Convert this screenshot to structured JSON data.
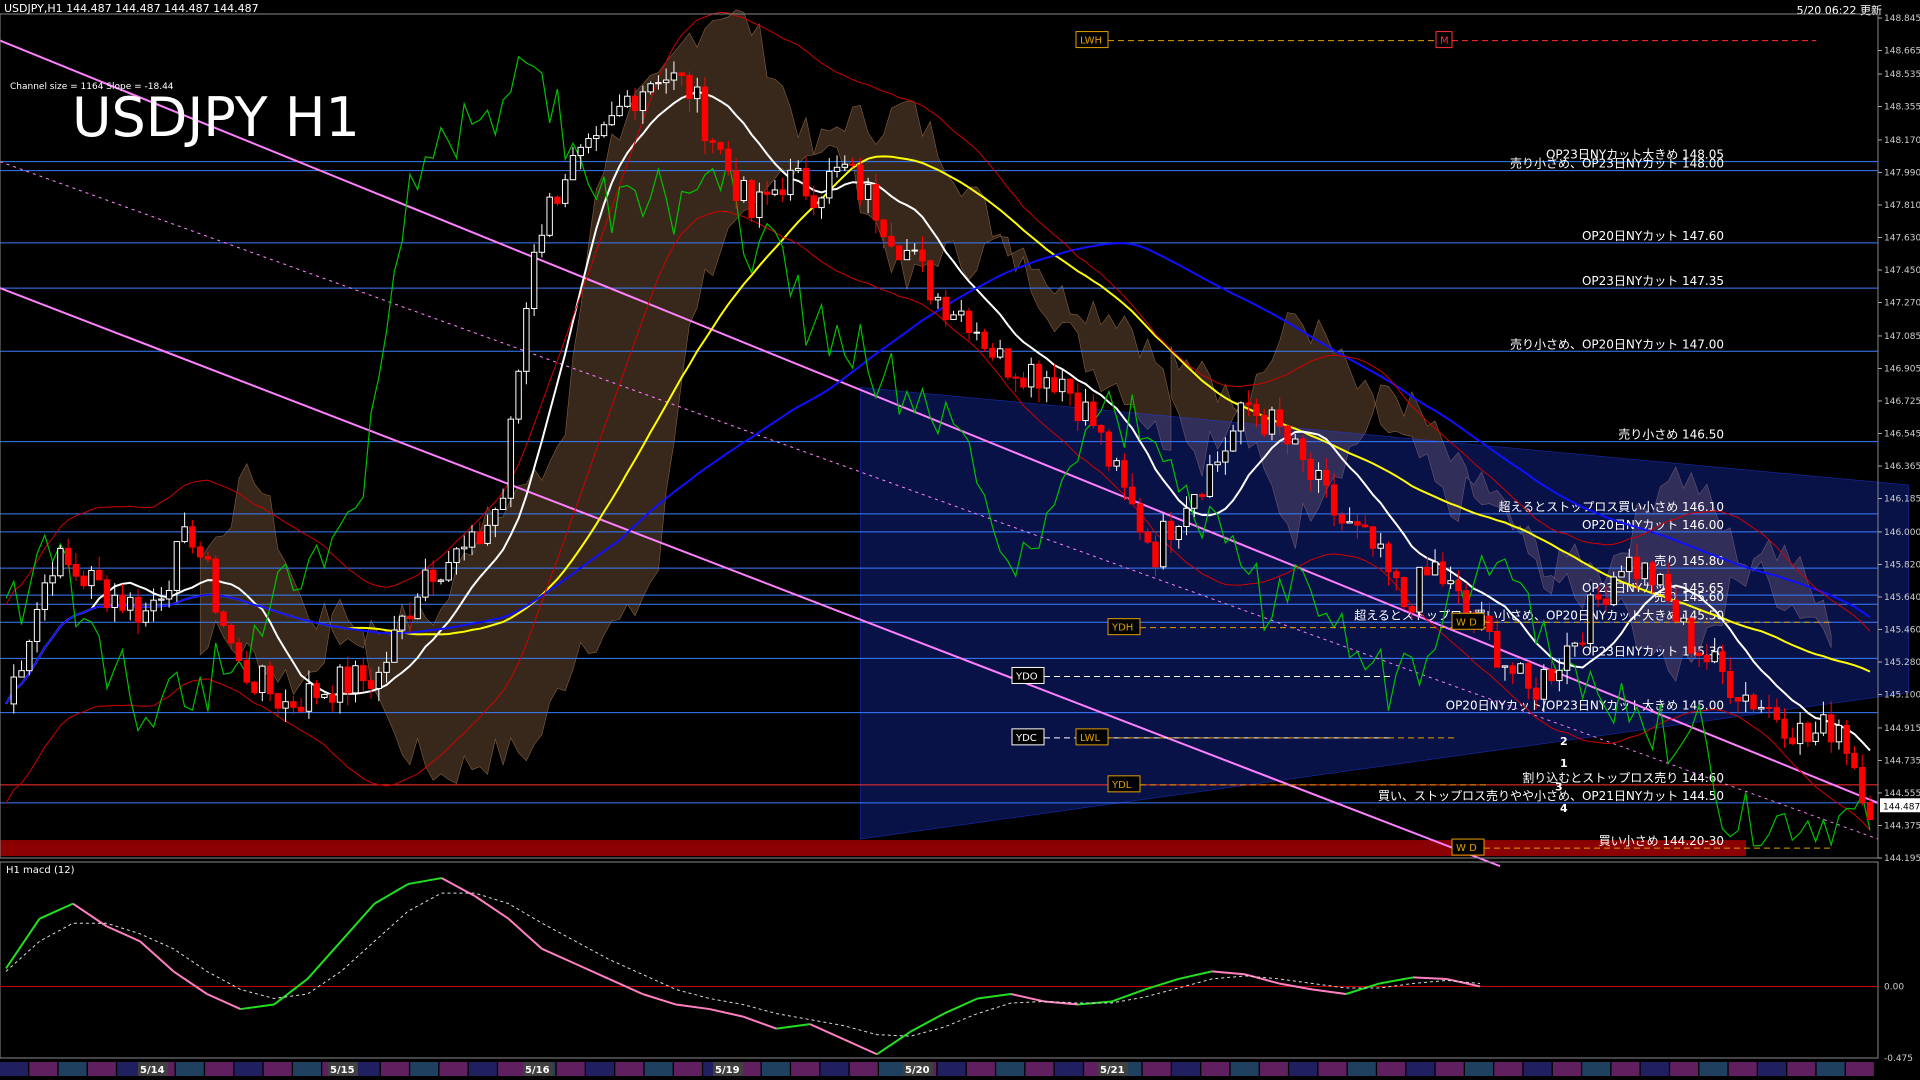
{
  "header": {
    "symbol_info": "USDJPY,H1  144.487 144.487 144.487 144.487",
    "timestamp": "5/20 06:22 更新"
  },
  "chart_data": [
    {
      "type": "candlestick",
      "title": "USDJPY H1",
      "subtitle": "Channel size = 1164 Slope = -18.44",
      "ylim": [
        144.195,
        148.845
      ],
      "y_ticks": [
        148.845,
        148.665,
        148.535,
        148.355,
        148.17,
        147.99,
        147.81,
        147.63,
        147.45,
        147.27,
        147.085,
        146.905,
        146.725,
        146.545,
        146.365,
        146.185,
        146.0,
        145.82,
        145.64,
        145.46,
        145.28,
        145.1,
        144.915,
        144.735,
        144.555,
        144.375,
        144.195
      ],
      "current_price": "144.487",
      "date_labels": [
        "5/14",
        "5/15",
        "5/16",
        "5/19",
        "5/20",
        "5/21"
      ],
      "candle_count": 240,
      "close_path": [
        [
          0,
          145.05
        ],
        [
          6,
          145.85
        ],
        [
          12,
          145.7
        ],
        [
          18,
          145.55
        ],
        [
          24,
          146.0
        ],
        [
          30,
          145.25
        ],
        [
          36,
          145.05
        ],
        [
          42,
          145.15
        ],
        [
          48,
          145.2
        ],
        [
          54,
          145.8
        ],
        [
          60,
          145.9
        ],
        [
          64,
          146.2
        ],
        [
          68,
          147.6
        ],
        [
          72,
          148.0
        ],
        [
          76,
          148.1
        ],
        [
          80,
          148.4
        ],
        [
          84,
          148.55
        ],
        [
          88,
          148.45
        ],
        [
          92,
          148.1
        ],
        [
          96,
          147.75
        ],
        [
          100,
          147.95
        ],
        [
          104,
          147.9
        ],
        [
          108,
          148.0
        ],
        [
          112,
          147.8
        ],
        [
          116,
          147.55
        ],
        [
          120,
          147.3
        ],
        [
          124,
          147.2
        ],
        [
          128,
          146.95
        ],
        [
          132,
          146.9
        ],
        [
          136,
          146.85
        ],
        [
          140,
          146.6
        ],
        [
          144,
          146.2
        ],
        [
          148,
          145.9
        ],
        [
          152,
          146.2
        ],
        [
          156,
          146.4
        ],
        [
          160,
          146.7
        ],
        [
          164,
          146.55
        ],
        [
          168,
          146.3
        ],
        [
          172,
          146.05
        ],
        [
          176,
          145.9
        ],
        [
          180,
          145.6
        ],
        [
          184,
          145.8
        ],
        [
          188,
          145.55
        ],
        [
          192,
          145.35
        ],
        [
          196,
          145.1
        ],
        [
          200,
          145.3
        ],
        [
          204,
          145.55
        ],
        [
          208,
          145.85
        ],
        [
          212,
          145.75
        ],
        [
          216,
          145.45
        ],
        [
          220,
          145.25
        ],
        [
          224,
          145.1
        ],
        [
          228,
          145.0
        ],
        [
          232,
          144.85
        ],
        [
          236,
          144.95
        ],
        [
          240,
          144.49
        ]
      ],
      "reference_lines": [
        {
          "label": "OP23日NYカット大きめ 148.05",
          "price": 148.05
        },
        {
          "label": "売り小さめ、OP23日NYカット 148.00",
          "price": 148.0
        },
        {
          "label": "OP20日NYカット 147.60",
          "price": 147.6
        },
        {
          "label": "OP23日NYカット 147.35",
          "price": 147.35
        },
        {
          "label": "売り小さめ、OP20日NYカット 147.00",
          "price": 147.0
        },
        {
          "label": "売り小さめ 146.50",
          "price": 146.5
        },
        {
          "label": "超えるとストップロス買い小さめ 146.10",
          "price": 146.1
        },
        {
          "label": "OP20日NYカット 146.00",
          "price": 146.0
        },
        {
          "label": "売り 145.80",
          "price": 145.8
        },
        {
          "label": "OP23日NYカット 145.65",
          "price": 145.65
        },
        {
          "label": "売り 145.60",
          "price": 145.6
        },
        {
          "label": "超えるとストップロス買い小さめ、OP20日NYカット大きめ 145.50",
          "price": 145.5
        },
        {
          "label": "OP23日NYカット 145.30",
          "price": 145.3
        },
        {
          "label": "OP20日NYカット/OP23日NYカット大きめ 145.00",
          "price": 145.0
        },
        {
          "label": "割り込むとストップロス売り 144.60",
          "price": 144.6
        },
        {
          "label": "買い、ストップロス売りやや小さめ、OP21日NYカット 144.50",
          "price": 144.5
        },
        {
          "label": "買い小さめ 144.20-30",
          "price": 144.25
        }
      ],
      "level_tags": [
        {
          "label": "LWH",
          "price": 148.72
        },
        {
          "label": "YDH",
          "price": 145.47
        },
        {
          "label": "YDO",
          "price": 145.2
        },
        {
          "label": "YDC",
          "price": 144.86
        },
        {
          "label": "LWL",
          "price": 144.86
        },
        {
          "label": "YDL",
          "price": 144.6
        },
        {
          "label": "W D",
          "price": 145.5
        },
        {
          "label": "W D",
          "price": 144.25
        },
        {
          "label": "M",
          "price": 148.72
        }
      ],
      "projection_labels": [
        "2",
        "1",
        "3",
        "4"
      ],
      "colors": {
        "up": "#ffffff",
        "down": "#ff0000",
        "ma_yellow": "#ffff00",
        "ma_white": "#ffffff",
        "ma_blue": "#1010ff",
        "channel": "#ff80ff",
        "chikou": "#00c000",
        "ref_line": "#3a7cff",
        "cloud_orange": "#c89060",
        "cloud_blue": "#2040ff"
      }
    },
    {
      "type": "line",
      "title": "H1  macd (12)",
      "ylim": [
        -0.475,
        0.8
      ],
      "y_ticks": [
        "0.00",
        "-0.475"
      ],
      "series": [
        {
          "values": [
            0.12,
            0.45,
            0.55,
            0.4,
            0.3,
            0.1,
            -0.05,
            -0.15,
            -0.12,
            0.05,
            0.3,
            0.55,
            0.68,
            0.72,
            0.6,
            0.45,
            0.25,
            0.15,
            0.05,
            -0.05,
            -0.12,
            -0.15,
            -0.2,
            -0.28,
            -0.25,
            -0.35,
            -0.45,
            -0.3,
            -0.18,
            -0.08,
            -0.05,
            -0.1,
            -0.12,
            -0.1,
            -0.02,
            0.05,
            0.1,
            0.08,
            0.02,
            -0.02,
            -0.05,
            0.02,
            0.06,
            0.05,
            0.0
          ]
        },
        {
          "values": [
            0.1,
            0.3,
            0.42,
            0.42,
            0.35,
            0.25,
            0.1,
            -0.02,
            -0.08,
            -0.05,
            0.1,
            0.3,
            0.5,
            0.62,
            0.62,
            0.55,
            0.42,
            0.3,
            0.18,
            0.08,
            -0.02,
            -0.08,
            -0.12,
            -0.18,
            -0.22,
            -0.26,
            -0.32,
            -0.33,
            -0.27,
            -0.18,
            -0.11,
            -0.1,
            -0.11,
            -0.11,
            -0.07,
            -0.01,
            0.05,
            0.07,
            0.05,
            0.02,
            -0.01,
            -0.01,
            0.02,
            0.04,
            0.02
          ]
        }
      ]
    }
  ]
}
